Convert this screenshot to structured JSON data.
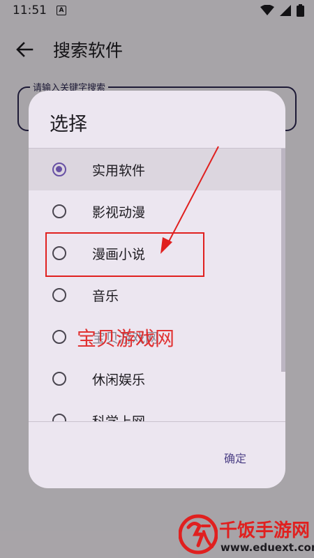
{
  "status_bar": {
    "time": "11:51",
    "notification_badge": "A"
  },
  "app_bar": {
    "title": "搜索软件",
    "back_icon": "arrow-left"
  },
  "search": {
    "label": "请输入关键字搜索"
  },
  "dialog": {
    "title": "选择",
    "options": [
      {
        "label": "实用软件",
        "selected": true
      },
      {
        "label": "影视动漫",
        "selected": false
      },
      {
        "label": "漫画小说",
        "selected": false
      },
      {
        "label": "音乐",
        "selected": false
      },
      {
        "label": "宝贝游戏网",
        "selected": false
      },
      {
        "label": "休闲娱乐",
        "selected": false
      },
      {
        "label": "科学上网",
        "selected": false
      }
    ],
    "confirm_label": "确定"
  },
  "overlay": {
    "watermark": "宝贝游戏网"
  },
  "logo": {
    "title": "千饭手游网",
    "url": "www.eduext.com"
  },
  "colors": {
    "accent": "#6750a4",
    "annotation": "#e0201f"
  }
}
